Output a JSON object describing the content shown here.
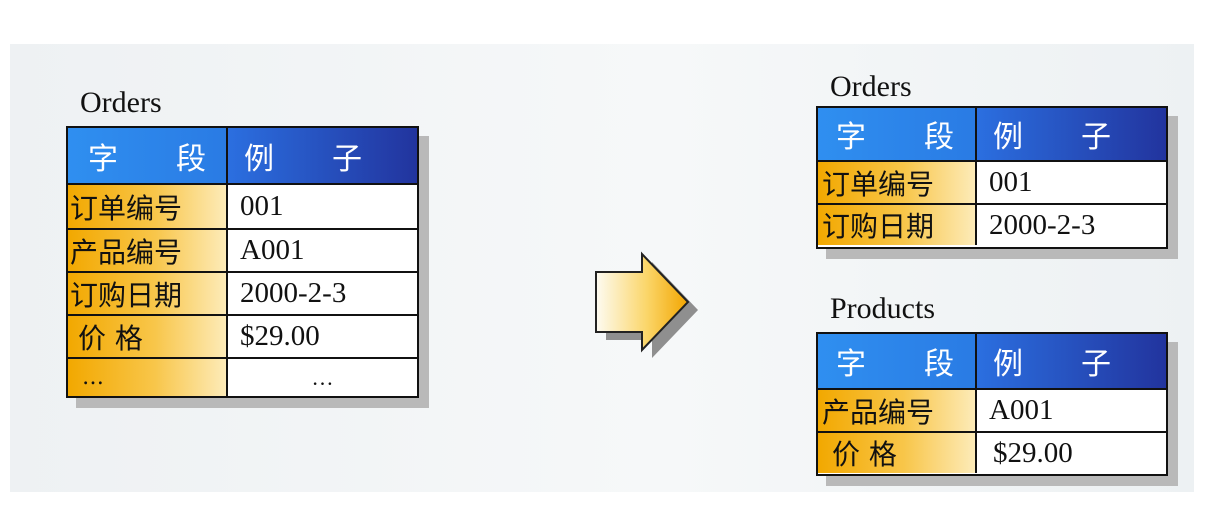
{
  "left": {
    "title": "Orders",
    "header": [
      "字　段",
      "例　子"
    ],
    "rows": [
      [
        "订单编号",
        "001"
      ],
      [
        "产品编号",
        "A001"
      ],
      [
        "订购日期",
        "2000-2-3"
      ],
      [
        "价 格",
        "$29.00"
      ],
      [
        "…",
        "…"
      ]
    ]
  },
  "right_orders": {
    "title": "Orders",
    "header": [
      "字　段",
      "例　子"
    ],
    "rows": [
      [
        "订单编号",
        "001"
      ],
      [
        "订购日期",
        "2000-2-3"
      ]
    ]
  },
  "right_products": {
    "title": "Products",
    "header": [
      "字　段",
      "例　子"
    ],
    "rows": [
      [
        "产品编号",
        "A001"
      ],
      [
        "价 格",
        "$29.00"
      ]
    ]
  },
  "colors": {
    "header_left": "#2f8ff0",
    "header_right": "#22349e",
    "field_gold": "#f2a800",
    "arrow_gold": "#f5b000",
    "shadow": "#b9b9b9"
  }
}
